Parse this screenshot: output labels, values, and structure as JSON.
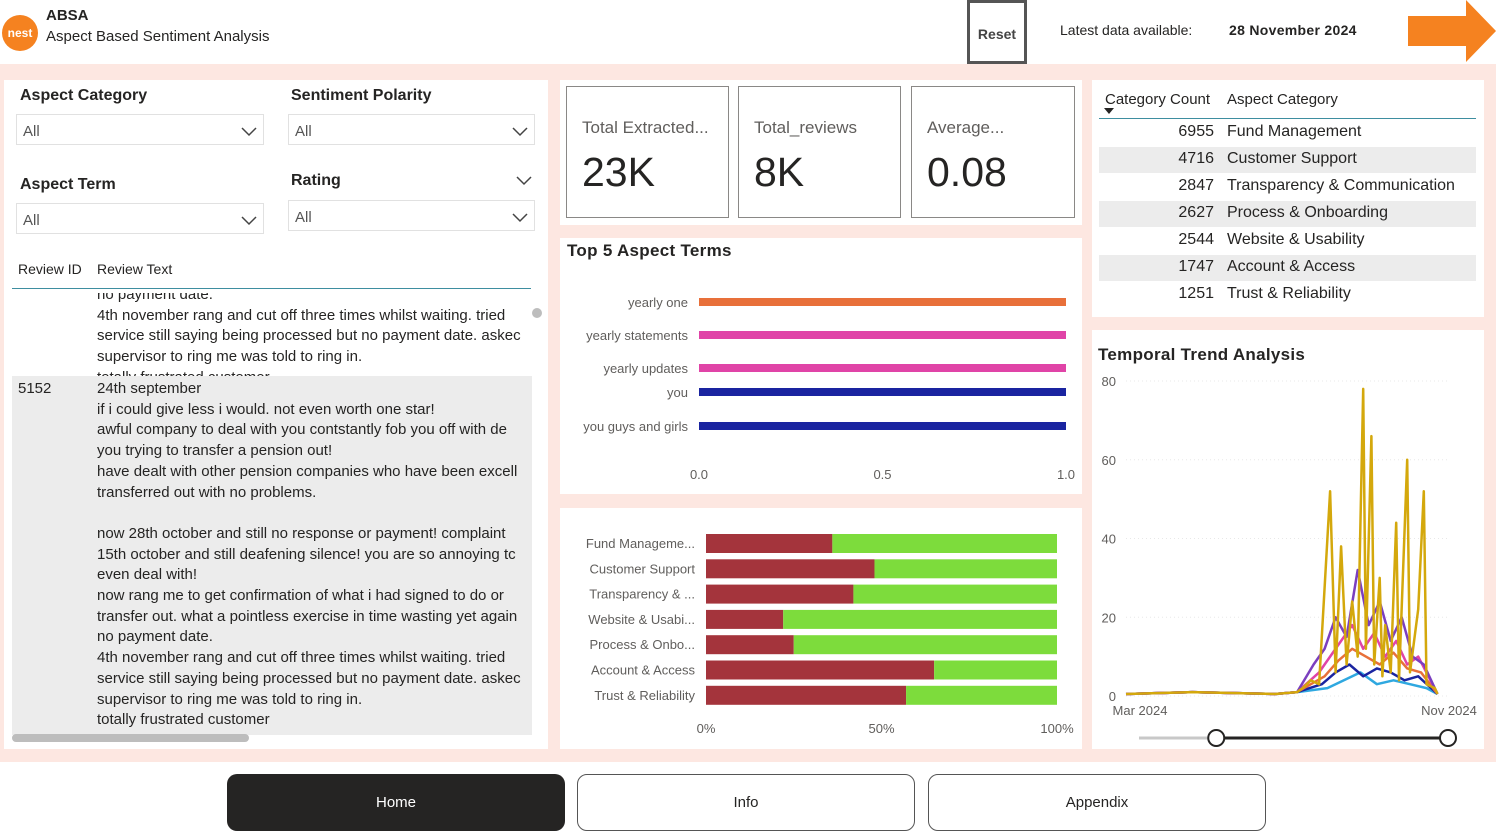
{
  "header": {
    "brand": "ABSA",
    "subtitle": "Aspect Based Sentiment Analysis",
    "logo_text": "nest",
    "reset_label": "Reset",
    "latest_label": "Latest data available:",
    "latest_value": "28 November 2024",
    "next_icon": "arrow-right-icon"
  },
  "slicers": {
    "aspect_category": {
      "title": "Aspect Category",
      "value": "All"
    },
    "sentiment_polarity": {
      "title": "Sentiment Polarity",
      "value": "All"
    },
    "aspect_term": {
      "title": "Aspect Term",
      "value": "All"
    },
    "rating": {
      "title": "Rating",
      "value": "All"
    }
  },
  "reviews": {
    "col_id": "Review ID",
    "col_text": "Review Text",
    "rows": [
      {
        "id": "",
        "lines": [
          "no payment date.",
          "4th november rang and cut off three times whilst waiting. tried",
          "service still saying being processed but no payment date. askec",
          "supervisor to ring me was told to ring in.",
          "totally frustrated customer"
        ]
      },
      {
        "id": "5152",
        "lines": [
          "24th september",
          "if i could give less i would. not even worth one star!",
          "awful company to deal with you contstantly fob you off with de",
          "you trying to transfer a pension out!",
          "have dealt with other pension companies who have been excell",
          "transferred out with no problems.",
          "",
          "now 28th october and still no response or payment! complaint",
          "15th october and still deafening silence! you are so annoying tc",
          "even deal with!",
          "now rang me to get confirmation of what i had signed to do or",
          "transfer out. what a pointless exercise in time wasting yet again",
          "no payment date.",
          "4th november rang and cut off three times whilst waiting. tried",
          "service still saying being processed but no payment date. askec",
          "supervisor to ring me was told to ring in.",
          "totally frustrated customer"
        ]
      }
    ]
  },
  "kpis": [
    {
      "label": "Total Extracted...",
      "value": "23K"
    },
    {
      "label": "Total_reviews",
      "value": "8K"
    },
    {
      "label": "Average...",
      "value": "0.08"
    }
  ],
  "category_table": {
    "col_count": "Category Count",
    "col_name": "Aspect Category",
    "rows": [
      {
        "count": "6955",
        "name": "Fund Management"
      },
      {
        "count": "4716",
        "name": "Customer Support"
      },
      {
        "count": "2847",
        "name": "Transparency & Communication"
      },
      {
        "count": "2627",
        "name": "Process & Onboarding"
      },
      {
        "count": "2544",
        "name": "Website & Usability"
      },
      {
        "count": "1747",
        "name": "Account & Access"
      },
      {
        "count": "1251",
        "name": "Trust & Reliability"
      }
    ]
  },
  "chart_data": [
    {
      "type": "bar",
      "title": "Top 5 Aspect Terms",
      "orientation": "horizontal",
      "categories": [
        "yearly one",
        "yearly statements",
        "yearly updates",
        "you",
        "you guys and girls"
      ],
      "values": [
        1.0,
        1.0,
        1.0,
        1.0,
        1.0
      ],
      "colors": [
        "#e8703a",
        "#e044a7",
        "#e044a7",
        "#1a24a0",
        "#1a24a0"
      ],
      "xlim": [
        0,
        1.0
      ],
      "x_ticks": [
        "0.0",
        "0.5",
        "1.0"
      ]
    },
    {
      "type": "bar",
      "stacked": "100%",
      "orientation": "horizontal",
      "title": "",
      "categories": [
        "Fund Manageme...",
        "Customer Support",
        "Transparency & ...",
        "Website & Usabi...",
        "Process & Onbo...",
        "Account & Access",
        "Trust & Reliability"
      ],
      "series": [
        {
          "color": "#a4343c",
          "values": [
            36,
            48,
            42,
            22,
            25,
            65,
            57
          ]
        },
        {
          "color": "#7ddc3c",
          "values": [
            64,
            52,
            58,
            78,
            75,
            35,
            43
          ]
        }
      ],
      "x_ticks": [
        "0%",
        "50%",
        "100%"
      ]
    },
    {
      "type": "line",
      "title": "Temporal Trend Analysis",
      "ylim": [
        0,
        80
      ],
      "y_ticks": [
        "0",
        "20",
        "40",
        "60",
        "80"
      ],
      "x_ticks": [
        "Mar 2024",
        "Nov 2024"
      ],
      "grid": true,
      "series": [
        {
          "color": "#d4a80c",
          "peaks": [
            [
              0.7,
              2
            ],
            [
              0.73,
              4
            ],
            [
              0.76,
              3
            ],
            [
              0.8,
              52
            ],
            [
              0.82,
              6
            ],
            [
              0.84,
              38
            ],
            [
              0.86,
              8
            ],
            [
              0.88,
              24
            ],
            [
              0.9,
              10
            ],
            [
              0.92,
              78
            ],
            [
              0.93,
              12
            ],
            [
              0.95,
              66
            ],
            [
              0.96,
              8
            ],
            [
              0.98,
              30
            ],
            [
              0.99,
              5
            ],
            [
              1.0,
              18
            ],
            [
              1.02,
              6
            ],
            [
              1.04,
              44
            ],
            [
              1.05,
              4
            ],
            [
              1.08,
              60
            ],
            [
              1.09,
              6
            ],
            [
              1.12,
              22
            ],
            [
              1.14,
              52
            ],
            [
              1.15,
              3
            ],
            [
              1.18,
              2
            ]
          ]
        },
        {
          "color": "#7b3fbf",
          "peaks": [
            [
              0.74,
              8
            ],
            [
              0.78,
              12
            ],
            [
              0.82,
              20
            ],
            [
              0.86,
              15
            ],
            [
              0.9,
              32
            ],
            [
              0.94,
              18
            ],
            [
              0.98,
              24
            ],
            [
              1.02,
              14
            ],
            [
              1.06,
              20
            ],
            [
              1.1,
              10
            ],
            [
              1.14,
              8
            ]
          ]
        },
        {
          "color": "#e044a7",
          "peaks": [
            [
              0.76,
              6
            ],
            [
              0.8,
              10
            ],
            [
              0.84,
              14
            ],
            [
              0.88,
              18
            ],
            [
              0.92,
              12
            ],
            [
              0.96,
              16
            ],
            [
              1.0,
              10
            ],
            [
              1.04,
              14
            ],
            [
              1.08,
              8
            ],
            [
              1.12,
              10
            ]
          ]
        },
        {
          "color": "#e8703a",
          "peaks": [
            [
              0.78,
              5
            ],
            [
              0.83,
              9
            ],
            [
              0.88,
              12
            ],
            [
              0.93,
              10
            ],
            [
              0.98,
              8
            ],
            [
              1.03,
              11
            ],
            [
              1.08,
              7
            ],
            [
              1.13,
              6
            ]
          ]
        },
        {
          "color": "#1a24a0",
          "peaks": [
            [
              0.77,
              3
            ],
            [
              0.82,
              6
            ],
            [
              0.87,
              8
            ],
            [
              0.92,
              5
            ],
            [
              0.97,
              7
            ],
            [
              1.02,
              6
            ],
            [
              1.07,
              4
            ],
            [
              1.12,
              5
            ]
          ]
        },
        {
          "color": "#2fa8e0",
          "peaks": [
            [
              0.79,
              2
            ],
            [
              0.85,
              4
            ],
            [
              0.91,
              6
            ],
            [
              0.97,
              3
            ],
            [
              1.03,
              4
            ],
            [
              1.09,
              3
            ],
            [
              1.15,
              2
            ]
          ]
        }
      ]
    }
  ],
  "slider": {
    "range": [
      0.25,
      1.0
    ]
  },
  "nav": {
    "home": "Home",
    "info": "Info",
    "appendix": "Appendix"
  }
}
